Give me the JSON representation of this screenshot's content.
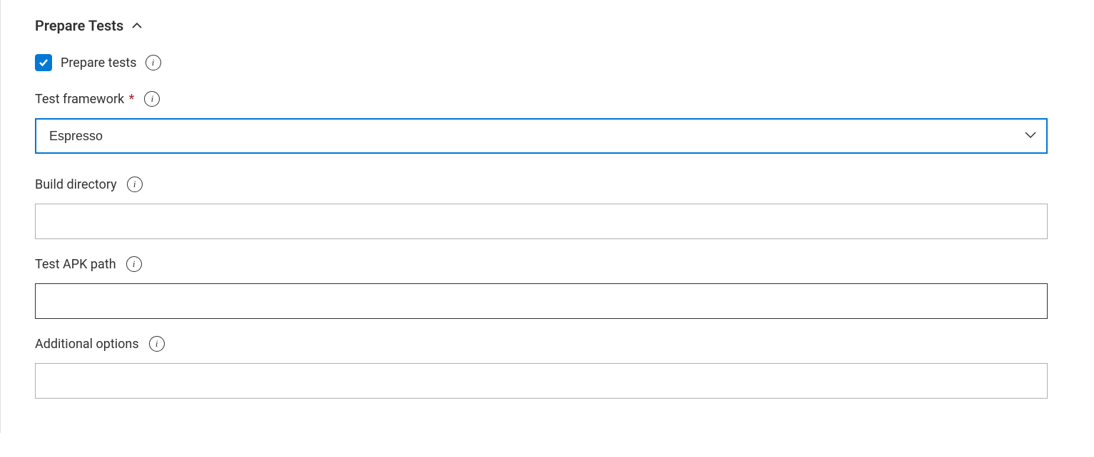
{
  "section": {
    "title": "Prepare Tests"
  },
  "checkbox": {
    "label": "Prepare tests",
    "checked": true
  },
  "fields": {
    "testFramework": {
      "label": "Test framework",
      "required": true,
      "value": "Espresso"
    },
    "buildDirectory": {
      "label": "Build directory",
      "value": ""
    },
    "testApkPath": {
      "label": "Test APK path",
      "value": ""
    },
    "additionalOptions": {
      "label": "Additional options",
      "value": ""
    }
  }
}
